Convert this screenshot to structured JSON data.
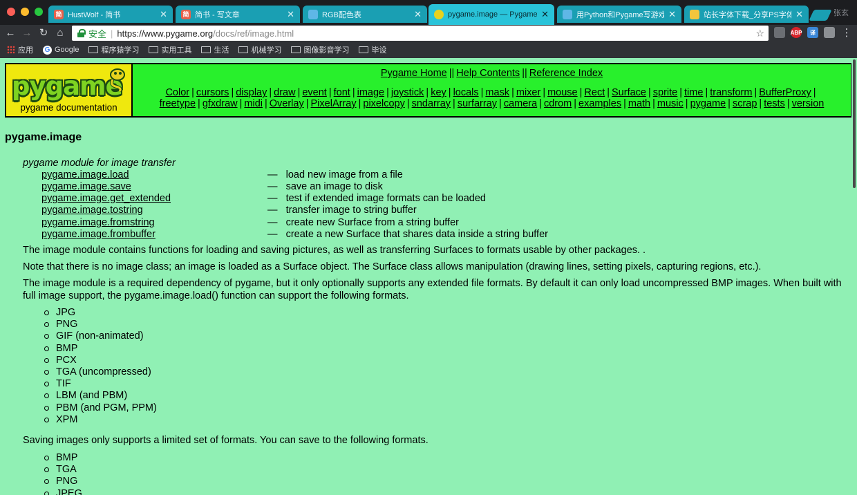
{
  "browser": {
    "tabs": [
      {
        "title": "HustWolf - 简书",
        "favicon": "简",
        "favicon_color": "#e8614b"
      },
      {
        "title": "简书 - 写文章",
        "favicon": "简",
        "favicon_color": "#e8614b"
      },
      {
        "title": "RGB配色表",
        "favicon": "",
        "favicon_color": "#5fb7e6"
      },
      {
        "title": "pygame.image — Pygame v",
        "favicon": "",
        "favicon_color": "#e8d21e"
      },
      {
        "title": "用Python和Pygame写游戏",
        "favicon": "",
        "favicon_color": "#5fb7e6"
      },
      {
        "title": "站长字体下载_分享PS字体",
        "favicon": "",
        "favicon_color": "#f2c53d"
      }
    ],
    "profile": "张玄",
    "secure_label": "安全",
    "url_host": "https://www.pygame.org",
    "url_path": "/docs/ref/image.html",
    "extensions": [
      "ABP",
      "译"
    ],
    "bookmarks": [
      "应用",
      "Google",
      "程序猿学习",
      "实用工具",
      "生活",
      "机械学习",
      "图像影音学习",
      "毕设"
    ]
  },
  "header": {
    "logo_text": "pygame",
    "logo_caption": "pygame documentation",
    "top_links": [
      "Pygame Home",
      "Help Contents",
      "Reference Index"
    ],
    "nav_row1": [
      "Color",
      "cursors",
      "display",
      "draw",
      "event",
      "font",
      "image",
      "joystick",
      "key",
      "locals",
      "mask",
      "mixer",
      "mouse",
      "Rect",
      "Surface",
      "sprite",
      "time",
      "transform",
      "BufferProxy"
    ],
    "nav_row2": [
      "freetype",
      "gfxdraw",
      "midi",
      "Overlay",
      "PixelArray",
      "pixelcopy",
      "sndarray",
      "surfarray",
      "camera",
      "cdrom",
      "examples",
      "math",
      "music",
      "pygame",
      "scrap",
      "tests",
      "version"
    ]
  },
  "main": {
    "title": "pygame.image",
    "subtitle": "pygame module for image transfer",
    "functions": [
      {
        "name": "pygame.image.load",
        "desc": "load new image from a file"
      },
      {
        "name": "pygame.image.save",
        "desc": "save an image to disk"
      },
      {
        "name": "pygame.image.get_extended",
        "desc": "test if extended image formats can be loaded"
      },
      {
        "name": "pygame.image.tostring",
        "desc": "transfer image to string buffer"
      },
      {
        "name": "pygame.image.fromstring",
        "desc": "create new Surface from a string buffer"
      },
      {
        "name": "pygame.image.frombuffer",
        "desc": "create a new Surface that shares data inside a string buffer"
      }
    ],
    "dash": "—",
    "para1": "The image module contains functions for loading and saving pictures, as well as transferring Surfaces to formats usable by other packages. .",
    "para2": "Note that there is no image class; an image is loaded as a Surface object. The Surface class allows manipulation (drawing lines, setting pixels, capturing regions, etc.).",
    "para3": "The image module is a required dependency of pygame, but it only optionally supports any extended file formats. By default it can only load uncompressed BMP images. When built with full image support, the pygame.image.load() function can support the following formats.",
    "load_formats": [
      "JPG",
      "PNG",
      "GIF (non-animated)",
      "BMP",
      "PCX",
      "TGA (uncompressed)",
      "TIF",
      "LBM (and PBM)",
      "PBM (and PGM, PPM)",
      "XPM"
    ],
    "para4": "Saving images only supports a limited set of formats. You can save to the following formats.",
    "save_formats": [
      "BMP",
      "TGA",
      "PNG",
      "JPEG"
    ]
  }
}
